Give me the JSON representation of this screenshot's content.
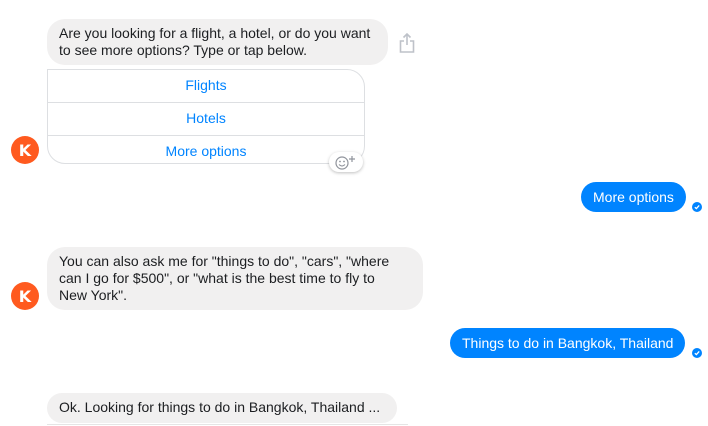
{
  "bot": {
    "avatar_letter": "K",
    "brand_color": "#ff5a1f"
  },
  "messages": {
    "prompt": "Are you looking for a flight, a hotel, or do you want\nto see more options? Type or tap below.",
    "quick_replies": [
      "Flights",
      "Hotels",
      "More options"
    ],
    "user_reply_1": "More options",
    "tip": "You can also ask me for \"things to do\", \"cars\", \"where\ncan I go for $500\", or \"what is the best time to fly to\nNew York\".",
    "user_reply_2": "Things to do in Bangkok, Thailand",
    "status": "Ok. Looking for things to do in Bangkok, Thailand ..."
  },
  "icons": {
    "share": "share-icon",
    "reaction": "add-reaction-icon",
    "seen": "seen-check-icon"
  },
  "colors": {
    "outgoing_bubble": "#0084ff",
    "incoming_bubble": "#f1f0f0",
    "link": "#0084ff"
  }
}
